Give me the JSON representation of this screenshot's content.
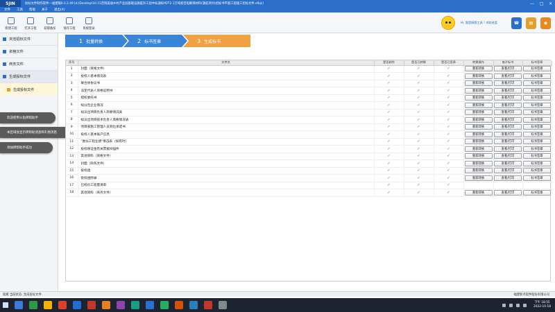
{
  "app": {
    "logo": "5JIN",
    "title": "投标文件制作软件---福建版6.0.2.49   [d:\\Desktop\\10.15范阳美丽乡村产业园基础设施提升工程中标通知书产2.1万吨新型电解液材料(源起项目)招标书平面工程施工招标文件.xfbjz]",
    "win_min": "—",
    "win_max": "□",
    "win_close": "✕"
  },
  "menu": [
    "文件",
    "工具",
    "帮助",
    "关于",
    "退出(X)"
  ],
  "toolbar": [
    {
      "label": "新建工程",
      "icon": "new-project-icon"
    },
    {
      "label": "打开工程",
      "icon": "open-project-icon"
    },
    {
      "label": "获取备份",
      "icon": "backup-icon"
    },
    {
      "label": "保存工程",
      "icon": "save-icon"
    },
    {
      "label": "系统登录",
      "icon": "login-icon"
    }
  ],
  "user": {
    "text": "Hi, 我是搞题工具 ! 求助进度"
  },
  "sidebar": {
    "items": [
      {
        "label": "浏览招标文件"
      },
      {
        "label": "资格文件"
      },
      {
        "label": "商务文件"
      },
      {
        "label": "生成投标文件"
      }
    ],
    "sub": {
      "label": "生成投标文件"
    }
  },
  "tips": [
    "欢迎使用斗鱼牌帮助手",
    "本区域会显示牌帮助消息和礼物消息",
    "添加牌帮助手成功"
  ],
  "steps": [
    {
      "num": "1",
      "label": "批量转换"
    },
    {
      "num": "2",
      "label": "标书签章"
    },
    {
      "num": "3",
      "label": "生成标书"
    }
  ],
  "table": {
    "headers": [
      "序号",
      "文件名",
      "是否制作",
      "是否已转换",
      "是否已签章",
      "转换操作",
      "电子标书",
      "标书签章"
    ],
    "btn_convert": "重新转换",
    "btn_view": "查看/打印",
    "btn_sign": "标书签章",
    "check": "✓",
    "rows": [
      {
        "no": "1",
        "name": "封面（资格文件）",
        "made": true,
        "conv": true,
        "sign": true,
        "btns": true
      },
      {
        "no": "2",
        "name": "投标人基本情况表",
        "made": true,
        "conv": true,
        "sign": true,
        "btns": true
      },
      {
        "no": "3",
        "name": "联合体协议书",
        "made": true,
        "conv": true,
        "sign": true,
        "btns": true
      },
      {
        "no": "4",
        "name": "法定代表人资格证明书",
        "made": true,
        "conv": true,
        "sign": true,
        "btns": true
      },
      {
        "no": "5",
        "name": "授权委托书",
        "made": true,
        "conv": true,
        "sign": true,
        "btns": true
      },
      {
        "no": "6",
        "name": "拟分包企业情况",
        "made": true,
        "conv": true,
        "sign": true,
        "btns": true
      },
      {
        "no": "7",
        "name": "拟派出项目负责人简要情况表",
        "made": true,
        "conv": true,
        "sign": true,
        "btns": true
      },
      {
        "no": "8",
        "name": "拟派出项目技术负责人简要情况表",
        "made": true,
        "conv": true,
        "sign": true,
        "btns": true
      },
      {
        "no": "9",
        "name": "项目部施工管理人员到位承诺书",
        "made": true,
        "conv": true,
        "sign": true,
        "btns": true
      },
      {
        "no": "10",
        "name": "投标人基本账户信息",
        "made": true,
        "conv": true,
        "sign": true,
        "btns": true
      },
      {
        "no": "11",
        "name": "\"类似工程业绩\"情况表（如有时）",
        "made": true,
        "conv": true,
        "sign": true,
        "btns": true
      },
      {
        "no": "12",
        "name": "投标保证金有关票据扫描件",
        "made": true,
        "conv": true,
        "sign": true,
        "btns": true
      },
      {
        "no": "13",
        "name": "其他资料（资格文件）",
        "made": true,
        "conv": true,
        "sign": true,
        "btns": true
      },
      {
        "no": "14",
        "name": "封面（商务文件）",
        "made": true,
        "conv": true,
        "sign": true,
        "btns": true
      },
      {
        "no": "15",
        "name": "投标函",
        "made": true,
        "conv": true,
        "sign": true,
        "btns": true
      },
      {
        "no": "16",
        "name": "投标函附录",
        "made": true,
        "conv": true,
        "sign": true,
        "btns": true
      },
      {
        "no": "17",
        "name": "已标价工程量清单",
        "made": true,
        "conv": true,
        "sign": true,
        "btns": false
      },
      {
        "no": "18",
        "name": "其他资料（商务文件）",
        "made": true,
        "conv": true,
        "sign": true,
        "btns": true
      }
    ]
  },
  "status": {
    "left": "就绪   当前状态:     生成投标文件",
    "right": "福建新点软件股份有限公司"
  },
  "clock": {
    "time": "下午 18:55",
    "date": "2022-10-18"
  }
}
